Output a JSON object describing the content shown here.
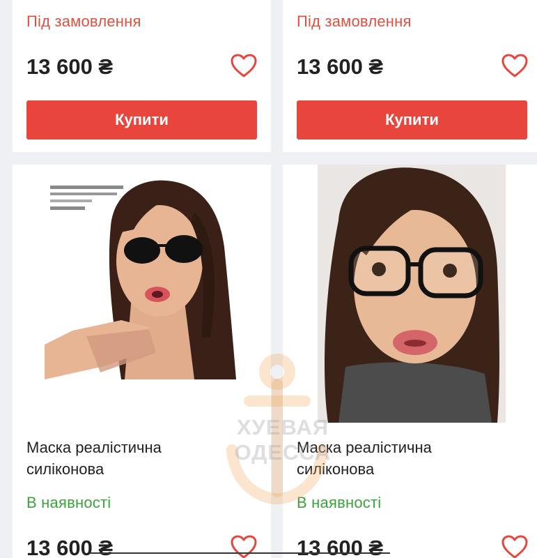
{
  "products_top": [
    {
      "status": "Під замовлення",
      "price": "13 600 ₴",
      "buy_label": "Купити"
    },
    {
      "status": "Під замовлення",
      "price": "13 600 ₴",
      "buy_label": "Купити"
    }
  ],
  "products_bottom": [
    {
      "image_icon": "product-photo",
      "title_line1": "Маска реалістична",
      "title_line2": "силіконова",
      "status": "В наявності",
      "price": "13 600 ₴"
    },
    {
      "image_icon": "product-photo",
      "title_line1": "Маска реалістична",
      "title_line2": "силіконова",
      "status": "В наявності",
      "price": "13 600 ₴"
    }
  ],
  "photo_label_text": [
    "INSTRUCTIONS",
    "Сorrespondence",
    "Contact",
    "Delivery"
  ],
  "watermark": "ХУЕВАЯ ОДЕССА",
  "colors": {
    "accent": "#e8453c",
    "in_stock": "#3aa43a",
    "on_order": "#e0503f",
    "background": "#eef0f4"
  },
  "icons": {
    "favorite": "heart-outline-icon",
    "watermark_logo": "anchor-icon"
  }
}
